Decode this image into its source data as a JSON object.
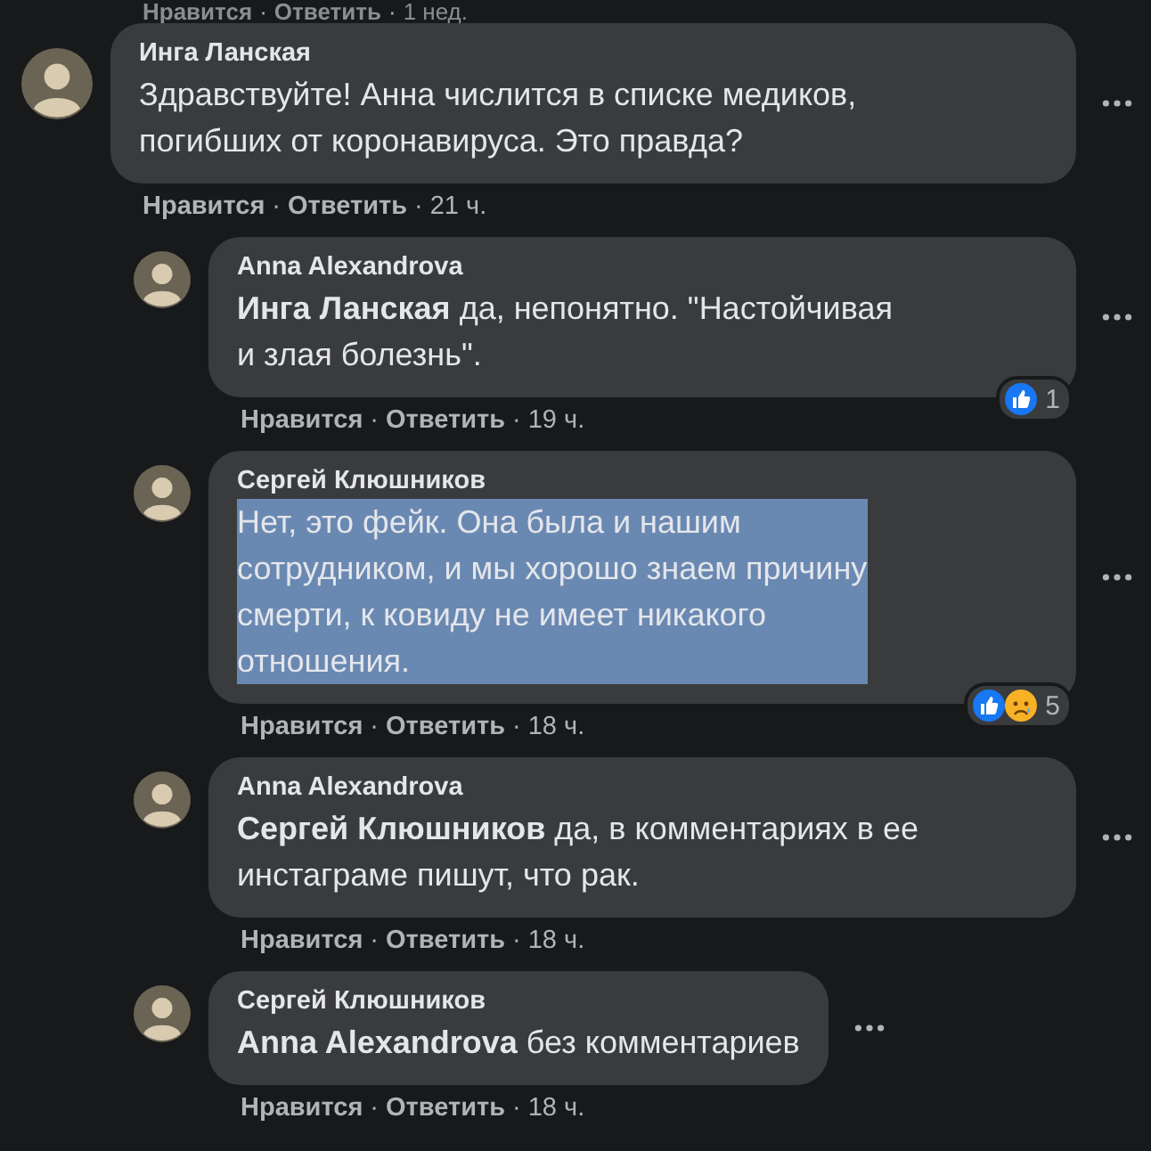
{
  "previous_actions": {
    "like": "Нравится",
    "separator": "·",
    "reply": "Ответить",
    "separator_2": "·",
    "time": "1 нед."
  },
  "comments": [
    {
      "author": "Инга Ланская",
      "text": "Здравствуйте! Анна числится в списке медиков,\nпогибших от коронавируса. Это правда?",
      "selected": false,
      "actions": {
        "like": "Нравится",
        "separator": "·",
        "reply": "Ответить",
        "separator_2": "·",
        "time": "21 ч."
      },
      "children": [
        {
          "author": "Anna Alexandrova",
          "text": "**Инга Ланская** да, непонятно. \"Настойчивая\nи злая болезнь\".",
          "selected": false,
          "actions": {
            "like": "Нравится",
            "separator": "·",
            "reply": "Ответить",
            "separator_2": "·",
            "time": "19 ч."
          },
          "reactions": {
            "icons": [
              {
                "kind": "like"
              }
            ],
            "count": "1"
          }
        },
        {
          "author": "Сергей Клюшников",
          "text": "Нет, это фейк. Она была и нашим\nсотрудником, и мы хорошо знаем причину\nсмерти, к ковиду не имеет никакого\nотношения.",
          "selected": true,
          "actions": {
            "like": "Нравится",
            "separator": "·",
            "reply": "Ответить",
            "separator_2": "·",
            "time": "18 ч."
          },
          "reactions": {
            "icons": [
              {
                "kind": "like"
              },
              {
                "kind": "sad"
              }
            ],
            "count": "5"
          }
        },
        {
          "author": "Anna Alexandrova",
          "text": "**Сергей Клюшников** да, в комментариях в ее\nинстаграме пишут, что рак.",
          "selected": false,
          "actions": {
            "like": "Нравится",
            "separator": "·",
            "reply": "Ответить",
            "separator_2": "·",
            "time": "18 ч."
          }
        },
        {
          "author": "Сергей Клюшников",
          "text": "**Anna Alexandrova** без комментариев",
          "selected": false,
          "actions": {
            "like": "Нравится",
            "separator": "·",
            "reply": "Ответить",
            "separator_2": "·",
            "time": "18 ч."
          }
        }
      ]
    }
  ]
}
